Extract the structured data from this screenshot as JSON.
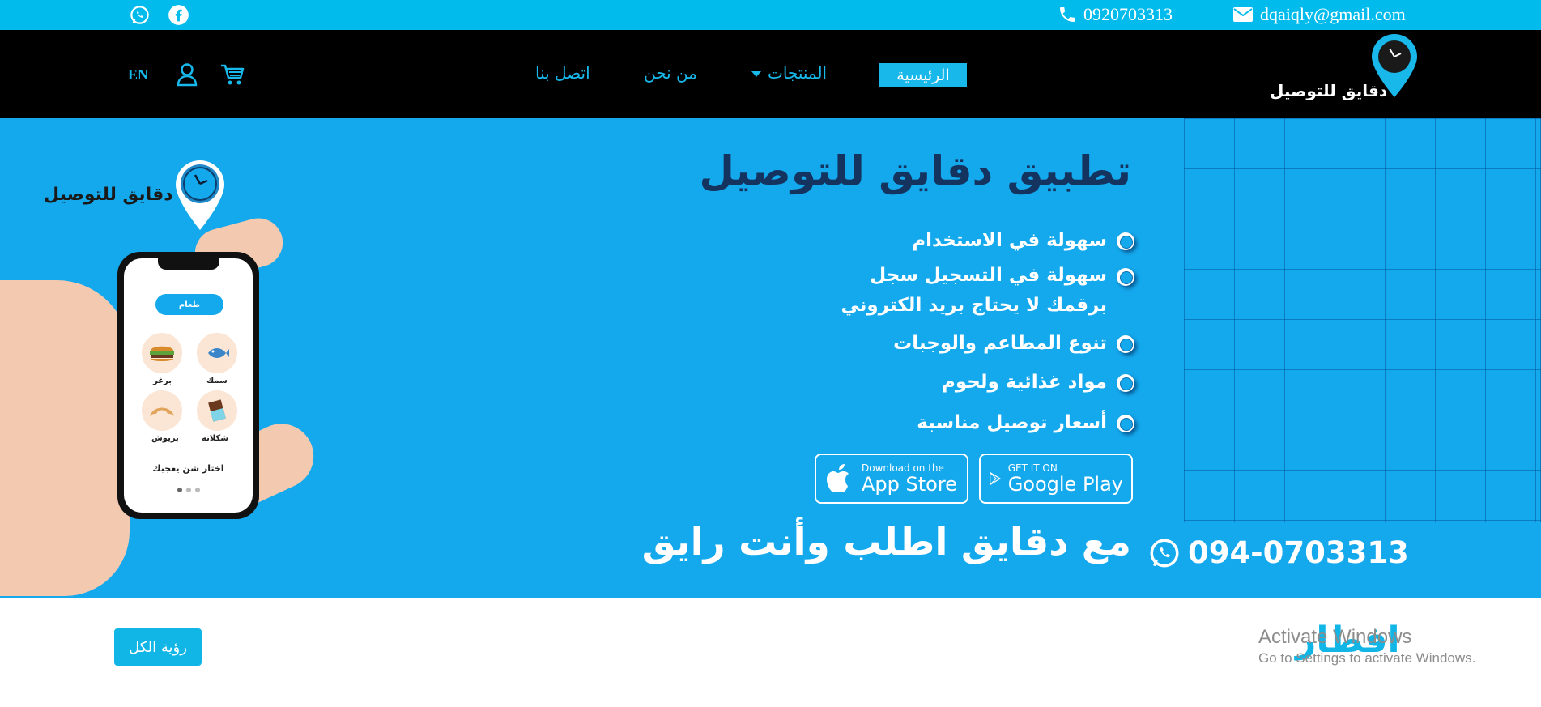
{
  "topbar": {
    "email": "dqaiqly@gmail.com",
    "phone": "0920703313",
    "social": [
      "whatsapp-icon",
      "facebook-icon"
    ]
  },
  "nav": {
    "logo_text": "دقايق للتوصيل",
    "items": {
      "home": "الرئيسية",
      "products": "المنتجات",
      "about": "من نحن",
      "contact": "اتصل بنا"
    },
    "language": "EN",
    "icons": [
      "cart-icon",
      "user-icon"
    ]
  },
  "hero": {
    "title": "تطبيق دقايق للتوصيل",
    "features": [
      "سهولة في الاستخدام",
      "سهولة في التسجيل سجل",
      "برقمك لا يحتاج بريد الكتروني",
      "تنوع المطاعم والوجبات",
      "مواد غذائية ولحوم",
      "أسعار توصيل مناسبة"
    ],
    "app_store": {
      "small": "Download on the",
      "big": "App Store"
    },
    "google_play": {
      "small": "GET IT ON",
      "big": "Google Play"
    },
    "slogan": "مع دقايق اطلب وأنت رايق",
    "whatsapp_number": "094-0703313",
    "logo_text": "دقايق للتوصيل",
    "phone_app": {
      "pill": "طعام",
      "foods": [
        "سمك",
        "برغر",
        "شكلاتة",
        "بريوش"
      ],
      "cta": "اختار شن يعجبك"
    }
  },
  "section": {
    "title": "افطار",
    "see_all": "رؤية الكل"
  },
  "watermark": {
    "line1": "Activate Windows",
    "line2": "Go to Settings to activate Windows."
  },
  "colors": {
    "topbar": "#00bbeb",
    "navbar": "#000000",
    "hero": "#14a8ec",
    "accent": "#19b8ea",
    "title_dark": "#14335f"
  }
}
